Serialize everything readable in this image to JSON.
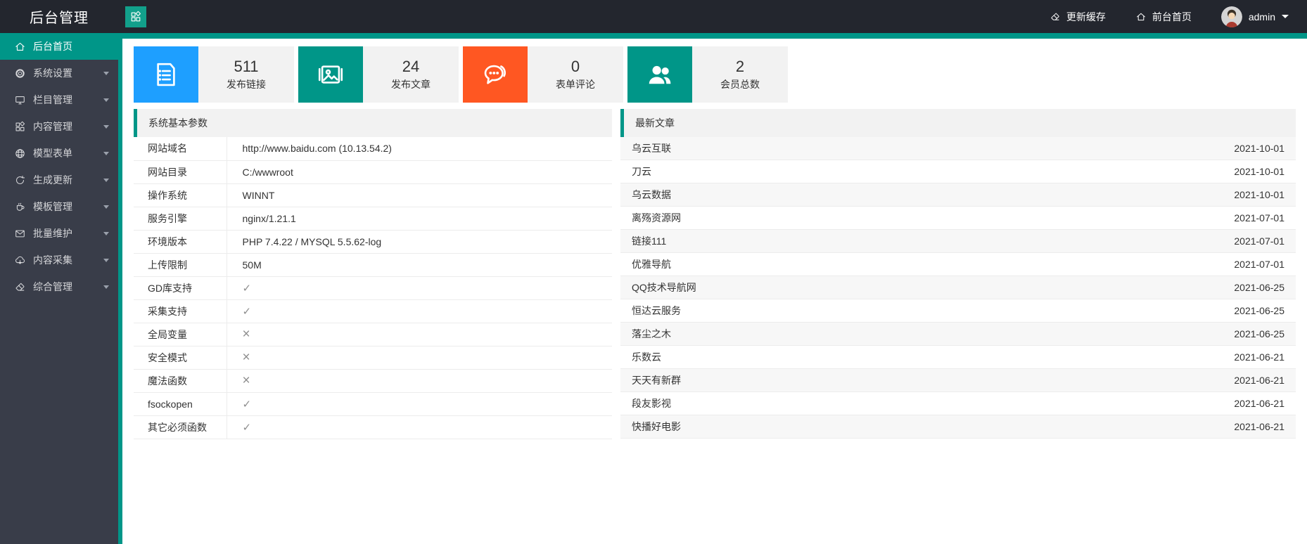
{
  "topbar": {
    "title": "后台管理",
    "actions": [
      {
        "id": "update-cache",
        "label": "更新缓存",
        "icon": "eraser-icon"
      },
      {
        "id": "frontend-home",
        "label": "前台首页",
        "icon": "home-icon"
      }
    ],
    "user": {
      "name": "admin"
    }
  },
  "sidebar": {
    "items": [
      {
        "id": "home",
        "label": "后台首页",
        "icon": "home-icon",
        "active": true,
        "has_submenu": false
      },
      {
        "id": "system-settings",
        "label": "系统设置",
        "icon": "gear-icon",
        "active": false,
        "has_submenu": true
      },
      {
        "id": "column-manage",
        "label": "栏目管理",
        "icon": "monitor-icon",
        "active": false,
        "has_submenu": true
      },
      {
        "id": "content-manage",
        "label": "内容管理",
        "icon": "grid-icon",
        "active": false,
        "has_submenu": true
      },
      {
        "id": "model-forms",
        "label": "模型表单",
        "icon": "globe-icon",
        "active": false,
        "has_submenu": true
      },
      {
        "id": "generate-update",
        "label": "生成更新",
        "icon": "refresh-icon",
        "active": false,
        "has_submenu": true
      },
      {
        "id": "template-manage",
        "label": "模板管理",
        "icon": "cup-icon",
        "active": false,
        "has_submenu": true
      },
      {
        "id": "batch-maintain",
        "label": "批量维护",
        "icon": "envelope-icon",
        "active": false,
        "has_submenu": true
      },
      {
        "id": "content-collect",
        "label": "内容采集",
        "icon": "cloud-download-icon",
        "active": false,
        "has_submenu": true
      },
      {
        "id": "general-manage",
        "label": "综合管理",
        "icon": "eraser-icon",
        "active": false,
        "has_submenu": true
      }
    ]
  },
  "stats": [
    {
      "id": "published-links",
      "value": "511",
      "label": "发布链接",
      "color": "#1E9FFF",
      "icon": "document-icon"
    },
    {
      "id": "published-articles",
      "value": "24",
      "label": "发布文章",
      "color": "#009688",
      "icon": "image-icon"
    },
    {
      "id": "form-comments",
      "value": "0",
      "label": "表单评论",
      "color": "#FF5722",
      "icon": "comments-icon"
    },
    {
      "id": "total-members",
      "value": "2",
      "label": "会员总数",
      "color": "#009688",
      "icon": "users-icon"
    }
  ],
  "system_panel": {
    "title": "系统基本参数",
    "rows": [
      {
        "label": "网站域名",
        "type": "text",
        "value": "http://www.baidu.com (10.13.54.2)"
      },
      {
        "label": "网站目录",
        "type": "text",
        "value": "C:/wwwroot"
      },
      {
        "label": "操作系统",
        "type": "text",
        "value": "WINNT"
      },
      {
        "label": "服务引擎",
        "type": "text",
        "value": "nginx/1.21.1"
      },
      {
        "label": "环境版本",
        "type": "text",
        "value": "PHP 7.4.22 / MYSQL 5.5.62-log"
      },
      {
        "label": "上传限制",
        "type": "text",
        "value": "50M"
      },
      {
        "label": "GD库支持",
        "type": "check",
        "value": "✓"
      },
      {
        "label": "采集支持",
        "type": "check",
        "value": "✓"
      },
      {
        "label": "全局变量",
        "type": "cross",
        "value": "×"
      },
      {
        "label": "安全模式",
        "type": "cross",
        "value": "×"
      },
      {
        "label": "魔法函数",
        "type": "cross",
        "value": "×"
      },
      {
        "label": "fsockopen",
        "type": "check",
        "value": "✓"
      },
      {
        "label": "其它必须函数",
        "type": "check",
        "value": "✓"
      }
    ]
  },
  "articles_panel": {
    "title": "最新文章",
    "items": [
      {
        "title": "乌云互联",
        "date": "2021-10-01"
      },
      {
        "title": "刀云",
        "date": "2021-10-01"
      },
      {
        "title": "乌云数据",
        "date": "2021-10-01"
      },
      {
        "title": "离殇资源网",
        "date": "2021-07-01"
      },
      {
        "title": "链接111",
        "date": "2021-07-01"
      },
      {
        "title": "优雅导航",
        "date": "2021-07-01"
      },
      {
        "title": "QQ技术导航网",
        "date": "2021-06-25"
      },
      {
        "title": "恒达云服务",
        "date": "2021-06-25"
      },
      {
        "title": "落尘之木",
        "date": "2021-06-25"
      },
      {
        "title": "乐数云",
        "date": "2021-06-21"
      },
      {
        "title": "天天有新群",
        "date": "2021-06-21"
      },
      {
        "title": "段友影视",
        "date": "2021-06-21"
      },
      {
        "title": "快播好电影",
        "date": "2021-06-21"
      }
    ]
  },
  "colors": {
    "accent_teal": "#009688",
    "stat_blue": "#1E9FFF",
    "stat_orange": "#FF5722",
    "topbar_bg": "#23262E",
    "sidebar_bg": "#393D49"
  }
}
